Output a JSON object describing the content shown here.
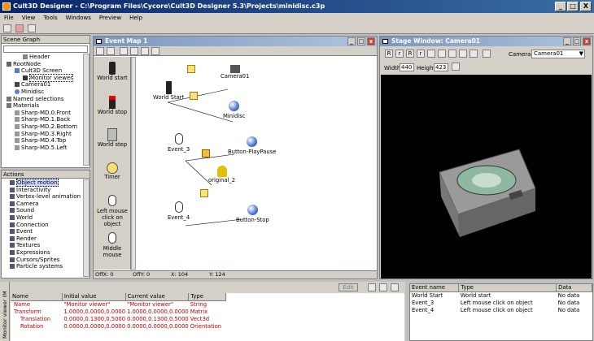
{
  "app": {
    "title": "Cult3D Designer - C:\\Program Files\\Cycore\\Cult3D Designer 5.3\\Projects\\minidisc.c3p",
    "win_buttons": [
      "_",
      "□",
      "X"
    ]
  },
  "menu": [
    "File",
    "View",
    "Tools",
    "Windows",
    "Preview",
    "Help"
  ],
  "scene_graph": {
    "title": "Scene Graph",
    "items": [
      "Header",
      "RootNode",
      "Cult3D Screen",
      "Monitor viewer",
      "Camera01",
      "Minidisc",
      "Named selections",
      "Materials",
      "Sharp-MD.0.Front",
      "Sharp-MD.1.Back",
      "Sharp-MD.2.Bottom",
      "Sharp-MD.3.Right",
      "Sharp-MD.4.Top",
      "Sharp-MD.5.Left"
    ]
  },
  "actions": {
    "title": "Actions",
    "items": [
      "Object motion",
      "Interactivity",
      "Vertex-level animation",
      "Camera",
      "Sound",
      "World",
      "Connection",
      "Event",
      "Render",
      "Textures",
      "Expressions",
      "Cursors/Sprites",
      "Particle systems"
    ]
  },
  "event_map": {
    "title": "Event Map 1",
    "toolbox": [
      "World start",
      "World stop",
      "World step",
      "Timer",
      "Left mouse click on object",
      "Middle mouse"
    ],
    "nodes": {
      "world_start": "World Start",
      "camera": "Camera01",
      "minidisc": "Minidisc",
      "event3": "Event_3",
      "bpp": "Button-PlayPause",
      "original": "original_2",
      "event4": "Event_4",
      "bstop": "Button-Stop"
    },
    "status": [
      "OffX: 0",
      "OffY: 0",
      "X: 104",
      "Y: 124"
    ]
  },
  "stage": {
    "title": "Stage Window: Camera01",
    "tools": [
      "R",
      "r",
      "R",
      "r"
    ],
    "camera_label": "Camera:",
    "camera_value": "Camera01",
    "width_label": "Width",
    "width_value": "440",
    "height_label": "Height",
    "height_value": "423",
    "colors": {
      "background": "#000000"
    }
  },
  "props": {
    "side_label": "Monitor viewer (M",
    "edit_label": "Edit",
    "columns": [
      "Name",
      "Initial value",
      "Current value",
      "Type"
    ],
    "rows": [
      [
        "Name",
        "\"Monitor viewer\"",
        "\"Monitor viewer\"",
        "String"
      ],
      [
        "Transform",
        "1.0000,0.0000,0.0000,0.0",
        "1.0000,0.0000,0.0000,0.0",
        "Matrix"
      ],
      [
        "Translation",
        "0.0000,0.1300,0.5000",
        "0.0000,0.1300,0.5000",
        "Vect3d"
      ],
      [
        "Rotation",
        "0.0000,0.0000,0.0000,1.0",
        "0.0000,0.0000,0.0000,1.0",
        "Orientation"
      ]
    ]
  },
  "events_list": {
    "columns": [
      "Event name",
      "Type",
      "Data"
    ],
    "rows": [
      [
        "World Start",
        "World start",
        "No data"
      ],
      [
        "Event_3",
        "Left mouse click on object",
        "No data"
      ],
      [
        "Event_4",
        "Left mouse click on object",
        "No data"
      ]
    ]
  }
}
